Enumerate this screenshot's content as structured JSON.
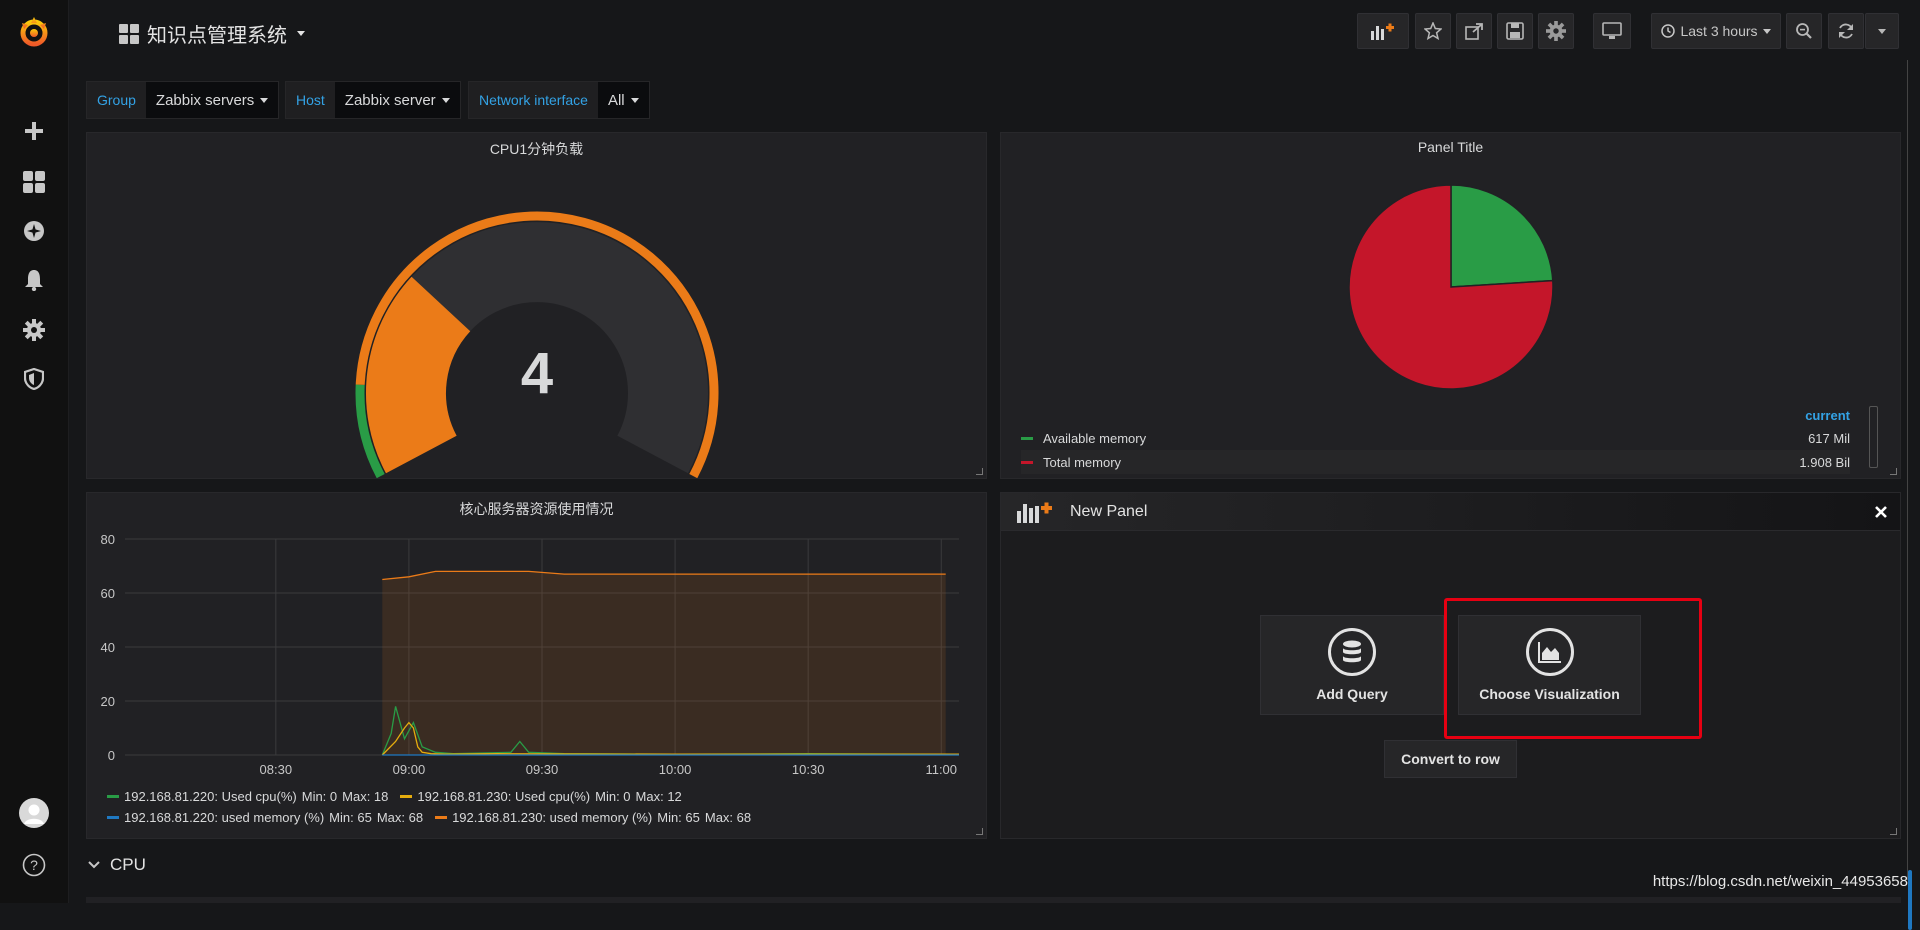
{
  "navbar": {
    "dashboard_title": "知识点管理系统",
    "time_range": "Last 3 hours"
  },
  "variables": [
    {
      "label": "Group",
      "value": "Zabbix servers"
    },
    {
      "label": "Host",
      "value": "Zabbix server"
    },
    {
      "label": "Network interface",
      "value": "All"
    }
  ],
  "gauge_panel": {
    "title": "CPU1分钟负载",
    "value": "4",
    "value_numeric": 4,
    "fill_fraction": 0.3,
    "threshold_color_ok": "#299c46",
    "threshold_color_warn": "#eb7b18"
  },
  "pie_panel": {
    "title": "Panel Title",
    "legend_header": "current",
    "items": [
      {
        "name": "Available memory",
        "value": "617 Mil",
        "color": "#299c46",
        "fraction": 0.24
      },
      {
        "name": "Total memory",
        "value": "1.908 Bil",
        "color": "#c4162a",
        "fraction": 0.76
      }
    ]
  },
  "graph_panel": {
    "title": "核心服务器资源使用情况",
    "legend": [
      {
        "text": "192.168.81.220: Used cpu(%)",
        "min": "Min: 0",
        "max": "Max: 18",
        "color": "#299c46"
      },
      {
        "text": "192.168.81.230: Used cpu(%)",
        "min": "Min: 0",
        "max": "Max: 12",
        "color": "#e5ac0e"
      },
      {
        "text": "192.168.81.220: used memory (%)",
        "min": "Min: 65",
        "max": "Max: 68",
        "color": "#1f78c1"
      },
      {
        "text": "192.168.81.230: used memory (%)",
        "min": "Min: 65",
        "max": "Max: 68",
        "color": "#eb7b18"
      }
    ]
  },
  "chart_data": {
    "type": "line",
    "title": "核心服务器资源使用情况",
    "xlabel": "",
    "ylabel": "",
    "ylim": [
      0,
      80
    ],
    "y_ticks": [
      "0",
      "20",
      "40",
      "60",
      "80"
    ],
    "x_ticks": [
      "08:30",
      "09:00",
      "09:30",
      "10:00",
      "10:30",
      "11:00"
    ],
    "x_tick_minutes": [
      510,
      540,
      570,
      600,
      630,
      660
    ],
    "xlim_minutes": [
      476,
      664
    ],
    "grid": true,
    "legend_position": "bottom",
    "series": [
      {
        "name": "192.168.81.230: used memory (%)",
        "color": "#eb7b18",
        "fill": true,
        "x": [
          534,
          540,
          546,
          556,
          567,
          575,
          590,
          610,
          630,
          645,
          655,
          661
        ],
        "y": [
          65,
          66,
          68,
          68,
          68,
          67,
          67,
          67,
          67,
          67,
          67,
          67
        ]
      },
      {
        "name": "192.168.81.220: Used cpu(%)",
        "color": "#299c46",
        "x": [
          534,
          536,
          537,
          539,
          541,
          543,
          546,
          550,
          563,
          565,
          567,
          575,
          600,
          630,
          664
        ],
        "y": [
          0,
          8,
          18,
          6,
          12,
          3,
          1,
          0.5,
          1,
          5,
          1,
          0.5,
          0.3,
          0.5,
          0.3
        ]
      },
      {
        "name": "192.168.81.230: Used cpu(%)",
        "color": "#e5ac0e",
        "x": [
          534,
          537,
          539,
          540,
          541,
          542,
          543,
          545,
          548,
          560,
          600,
          640,
          664
        ],
        "y": [
          0,
          5,
          10,
          12,
          10,
          3,
          1,
          0.5,
          0.3,
          0.5,
          0.3,
          0.3,
          0.3
        ]
      },
      {
        "name": "192.168.81.220: used memory (%)",
        "color": "#1f78c1",
        "x": [
          534,
          664
        ],
        "y": [
          0,
          0
        ]
      }
    ]
  },
  "new_panel": {
    "title": "New Panel",
    "add_query": "Add Query",
    "choose_visualization": "Choose Visualization",
    "convert_to_row": "Convert to row"
  },
  "row": {
    "title": "CPU"
  },
  "watermark": "https://blog.csdn.net/weixin_44953658"
}
